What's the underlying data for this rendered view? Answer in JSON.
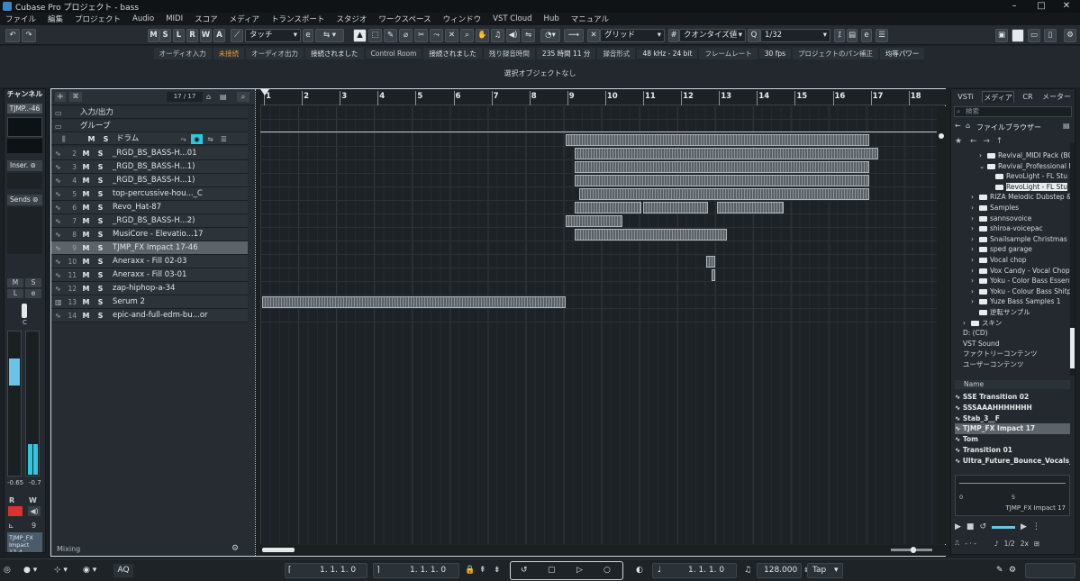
{
  "window": {
    "title": "Cubase Pro プロジェクト - bass",
    "min": "–",
    "max": "□",
    "close": "✕"
  },
  "menu": [
    "ファイル",
    "編集",
    "プロジェクト",
    "Audio",
    "MIDI",
    "スコア",
    "メディア",
    "トランスポート",
    "スタジオ",
    "ワークスペース",
    "ウィンドウ",
    "VST Cloud",
    "Hub",
    "マニュアル"
  ],
  "toolbar": {
    "msl": [
      "M",
      "S",
      "L",
      "R",
      "W",
      "A"
    ],
    "automation_mode": "タッチ",
    "snap_type": "グリッド",
    "quantize_type": "クオンタイズ値",
    "quantize_value": "1/32"
  },
  "infoline": {
    "audio_in_label": "オーディオ入力",
    "audio_in_value": "未接続",
    "audio_out_label": "オーディオ出力",
    "audio_out_value": "接続されました",
    "control_room_label": "Control Room",
    "control_room_value": "接続されました",
    "rec_time_label": "残り録音時間",
    "rec_time_value": "235 時間 11 分",
    "rec_format_label": "録音形式",
    "rec_format_value": "48 kHz - 24 bit",
    "frame_rate_label": "フレームレート",
    "frame_rate_value": "30 fps",
    "pan_label": "プロジェクトのパン補正",
    "pan_value": "均等パワー"
  },
  "selection_text": "選択オブジェクトなし",
  "inspector": {
    "header": "チャンネル",
    "channel": "TJMP..-46",
    "inserts": "Inser.",
    "sends": "Sends",
    "m": "M",
    "s": "S",
    "l": "L",
    "e": "e",
    "pan": "C",
    "vol_left": "-0.65",
    "vol_right": "-0.7",
    "r": "R",
    "w": "W",
    "count": "9",
    "bottom_name": "TJMP_FX Impact 17-4..."
  },
  "tracklist": {
    "counter": "17 / 17",
    "folders": [
      {
        "label": "入力/出力"
      },
      {
        "label": "グループ"
      }
    ],
    "drum_label": "ドラム",
    "tracks": [
      {
        "num": "2",
        "name": "_RGD_BS_BASS-H...01",
        "icon": "wave"
      },
      {
        "num": "3",
        "name": "_RGD_BS_BASS-H...1)",
        "icon": "wave"
      },
      {
        "num": "4",
        "name": "_RGD_BS_BASS-H...1)",
        "icon": "wave"
      },
      {
        "num": "5",
        "name": "top-percussive-hou..._C",
        "icon": "wave"
      },
      {
        "num": "6",
        "name": "Revo_Hat-87",
        "icon": "wave"
      },
      {
        "num": "7",
        "name": "_RGD_BS_BASS-H...2)",
        "icon": "wave"
      },
      {
        "num": "8",
        "name": "MusiCore - Elevatio...17",
        "icon": "wave"
      },
      {
        "num": "9",
        "name": "TJMP_FX Impact 17-46",
        "icon": "wave",
        "selected": true
      },
      {
        "num": "10",
        "name": "Aneraxx - Fill 02-03",
        "icon": "wave"
      },
      {
        "num": "11",
        "name": "Aneraxx - Fill 03-01",
        "icon": "wave"
      },
      {
        "num": "12",
        "name": "zap-hiphop-a-34",
        "icon": "wave"
      },
      {
        "num": "13",
        "name": "Serum 2",
        "icon": "instrument"
      },
      {
        "num": "14",
        "name": "epic-and-full-edm-bu...or",
        "icon": "wave"
      }
    ],
    "bottom_label": "Mixing",
    "m": "M",
    "s": "S"
  },
  "ruler": [
    "1",
    "2",
    "3",
    "4",
    "5",
    "6",
    "7",
    "8",
    "9",
    "10",
    "11",
    "12",
    "13",
    "14",
    "15",
    "16",
    "17",
    "18"
  ],
  "events": [
    {
      "lane": 2,
      "start": 9.0,
      "end": 17.0
    },
    {
      "lane": 3,
      "start": 9.25,
      "end": 17.25
    },
    {
      "lane": 4,
      "start": 9.25,
      "end": 17.0
    },
    {
      "lane": 5,
      "start": 9.25,
      "end": 17.0
    },
    {
      "lane": 6,
      "start": 9.35,
      "end": 17.0
    },
    {
      "lane": 7,
      "start": 9.25,
      "end": 11.0
    },
    {
      "lane": 7,
      "start": 11.05,
      "end": 12.75
    },
    {
      "lane": 7,
      "start": 13.0,
      "end": 14.75
    },
    {
      "lane": 8,
      "start": 9.0,
      "end": 10.5
    },
    {
      "lane": 9,
      "start": 9.25,
      "end": 13.25
    },
    {
      "lane": 11,
      "start": 12.7,
      "end": 12.95
    },
    {
      "lane": 12,
      "start": 12.85,
      "end": 12.95
    },
    {
      "lane": 14,
      "start": 1.0,
      "end": 9.0
    }
  ],
  "mediabay": {
    "tabs": [
      "VSTi",
      "メディア",
      "CR",
      "メーター"
    ],
    "search_placeholder": "検索",
    "browser_title": "ファイルブラウザー",
    "tree": [
      {
        "label": "Revival_MIDI Pack (BO",
        "indent": 3,
        "arrow": "›"
      },
      {
        "label": "Revival_Professional F",
        "indent": 3,
        "arrow": "⌄"
      },
      {
        "label": "RevoLight - FL Stu",
        "indent": 4,
        "arrow": ""
      },
      {
        "label": "RevoLight - FL Stu",
        "indent": 4,
        "arrow": "",
        "hl": true
      },
      {
        "label": "RIZA Melodic Dubstep &",
        "indent": 2,
        "arrow": "›"
      },
      {
        "label": "Samples",
        "indent": 2,
        "arrow": "›"
      },
      {
        "label": "sannsovoice",
        "indent": 2,
        "arrow": "›"
      },
      {
        "label": "shiroa-voicepac",
        "indent": 2,
        "arrow": "›"
      },
      {
        "label": "Snailsample Christmas",
        "indent": 2,
        "arrow": "›"
      },
      {
        "label": "sped garage",
        "indent": 2,
        "arrow": "›"
      },
      {
        "label": "Vocal chop",
        "indent": 2,
        "arrow": "›"
      },
      {
        "label": "Vox Candy - Vocal Chops",
        "indent": 2,
        "arrow": "›"
      },
      {
        "label": "Yoku - Color Bass Essentia",
        "indent": 2,
        "arrow": "›"
      },
      {
        "label": "Yoku - Colour Bass Shitpo",
        "indent": 2,
        "arrow": "›"
      },
      {
        "label": "Yuze Bass Samples 1",
        "indent": 2,
        "arrow": "›"
      },
      {
        "label": "逆転サンプル",
        "indent": 2,
        "arrow": ""
      },
      {
        "label": "スキン",
        "indent": 1,
        "arrow": "›"
      },
      {
        "label": "D: (CD)",
        "indent": 0,
        "arrow": ""
      },
      {
        "label": "VST Sound",
        "indent": 0,
        "arrow": ""
      },
      {
        "label": "ファクトリーコンテンツ",
        "indent": 0,
        "arrow": ""
      },
      {
        "label": "ユーザーコンテンツ",
        "indent": 0,
        "arrow": ""
      }
    ],
    "list_header": "Name",
    "list": [
      "SSE Transition 02",
      "SSSAAAHHHHHHH",
      "Stab_3__F",
      "TJMP_FX Impact 17",
      "Tom",
      "Transition 01",
      "Ultra_Future_Bounce_Vocals_1_3_1"
    ],
    "preview": {
      "left_num": "0",
      "mid_num": "5",
      "name": "TJMP_FX Impact 17"
    },
    "bottom": {
      "fraction": "1/2",
      "speed": "2x"
    }
  },
  "transport": {
    "pos_left": "1. 1. 1.  0",
    "pos_right": "1. 1. 1.  0",
    "pos_main": "1. 1. 1.  0",
    "tempo": "128.000",
    "tap": "Tap",
    "aq": "AQ"
  }
}
